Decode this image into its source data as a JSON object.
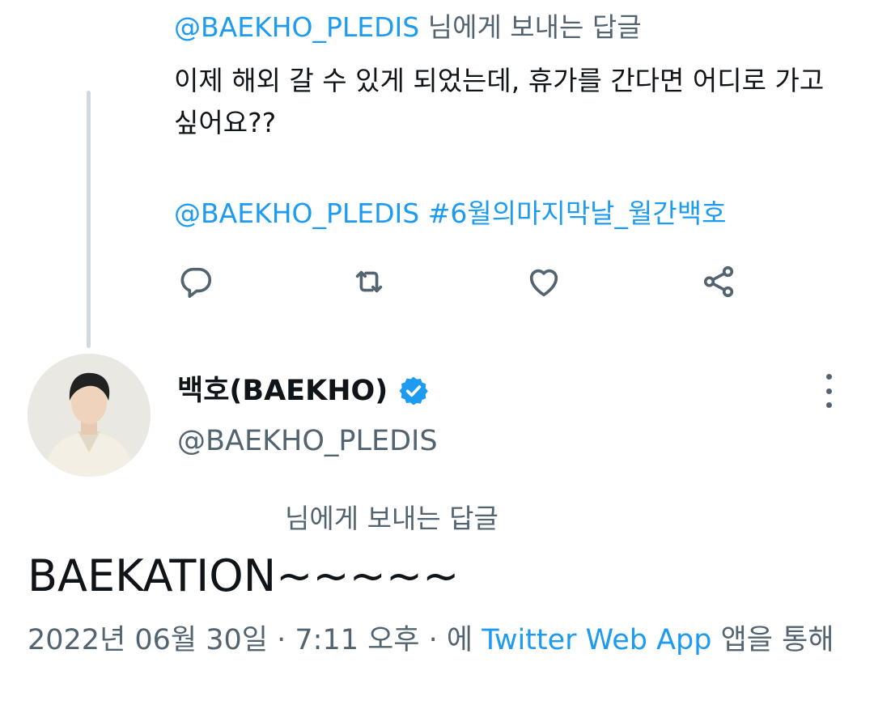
{
  "parent_tweet": {
    "mention": "@BAEKHO_PLEDIS",
    "replying_suffix": " 님에게 보내는 답글",
    "text_line1": "이제 해외 갈 수 있게 되었는데, 휴가를 간다면 어디로 가고",
    "text_line2": "싶어요??",
    "mention2": "@BAEKHO_PLEDIS",
    "hashtag": "#6월의마지막날_월간백호",
    "actions": [
      "reply-icon",
      "retweet-icon",
      "like-icon",
      "share-icon"
    ]
  },
  "main_tweet": {
    "display_name": "백호(BAEKHO)",
    "verified": true,
    "handle": "@BAEKHO_PLEDIS",
    "replying_to": "님에게 보내는 답글",
    "text": "BAEKATION~~~~~",
    "date": "2022년 06월 30일",
    "separator": " · ",
    "time": "7:11 오후",
    "source_prefix": "에 ",
    "source_app": "Twitter Web App",
    "source_suffix": " 앱을 통해"
  },
  "colors": {
    "link": "#1d9bf0",
    "muted": "#536471",
    "text": "#0f1419",
    "thread_line": "#cfd9de"
  }
}
